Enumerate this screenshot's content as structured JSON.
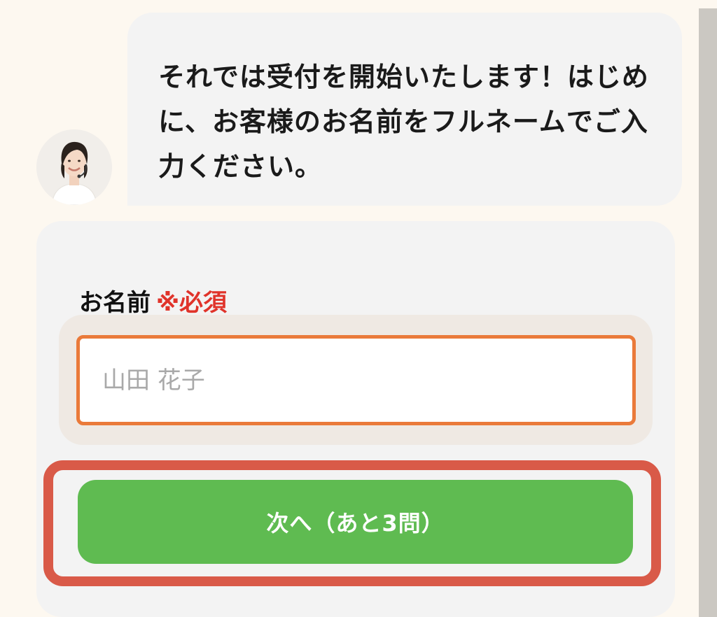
{
  "chat": {
    "message": "それでは受付を開始いたします！はじめに、お客様のお名前をフルネームでご入力ください。"
  },
  "form": {
    "label": "お名前",
    "required": "※必須",
    "name_placeholder": "山田 花子",
    "name_value": "",
    "next_button": "次へ（あと3問）"
  },
  "colors": {
    "page_bg": "#fdf8f0",
    "bubble_bg": "#f3f3f3",
    "required_text": "#e0332a",
    "input_border": "#ea7a3a",
    "button_bg": "#5fbb51",
    "highlight_border": "#d95a48"
  },
  "icons": {
    "avatar": "operator-avatar"
  }
}
